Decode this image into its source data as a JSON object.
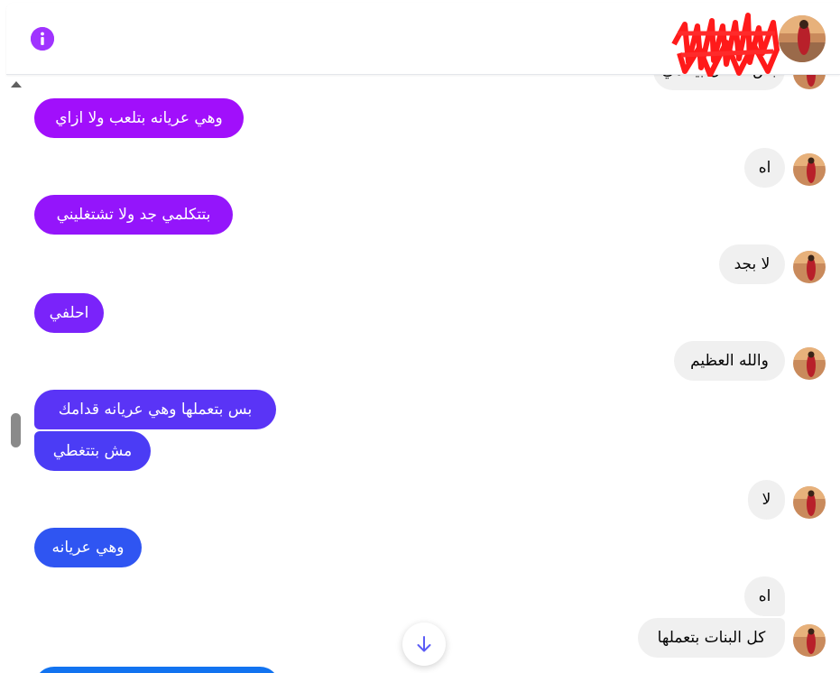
{
  "header": {
    "info_icon": "info-icon",
    "contact_name_redacted": true,
    "accent_color": "#a033ff"
  },
  "messages": [
    {
      "side": "in",
      "text": "بس عشان بيدامي"
    },
    {
      "side": "out",
      "text": "وهي عريانه بتلعب ولا ازاي"
    },
    {
      "side": "in",
      "text": "اه"
    },
    {
      "side": "out",
      "text": "بتتكلمي جد ولا تشتغليني"
    },
    {
      "side": "in",
      "text": "لا بجد"
    },
    {
      "side": "out",
      "text": "احلفي"
    },
    {
      "side": "in",
      "text": "والله العظيم"
    },
    {
      "side": "out",
      "text": "بس بتعملها وهي عريانه قدامك"
    },
    {
      "side": "out",
      "text": "مش بتتغطي"
    },
    {
      "side": "in",
      "text": "لا"
    },
    {
      "side": "out",
      "text": "وهي عريانه"
    },
    {
      "side": "in",
      "text": "اه"
    },
    {
      "side": "in",
      "text": "كل البنات بتعملها"
    }
  ],
  "scroll_down_icon": "arrow-down-icon"
}
